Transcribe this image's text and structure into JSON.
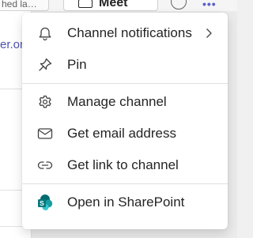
{
  "background": {
    "tab_text": "hed la…",
    "meet_label": "Meet",
    "link_text": "er.or"
  },
  "menu": {
    "items": [
      {
        "label": "Channel notifications",
        "icon": "bell-icon",
        "has_submenu": true
      },
      {
        "label": "Pin",
        "icon": "pin-icon"
      },
      {
        "label": "Manage channel",
        "icon": "gear-icon"
      },
      {
        "label": "Get email address",
        "icon": "mail-icon"
      },
      {
        "label": "Get link to channel",
        "icon": "link-icon"
      },
      {
        "label": "Open in SharePoint",
        "icon": "sharepoint-icon"
      }
    ]
  },
  "colors": {
    "text": "#242424",
    "icon": "#424242",
    "accent": "#5b5fc7",
    "sharepoint_dark": "#036c70",
    "sharepoint_mid": "#1a9ba1",
    "sharepoint_light": "#37c6d0"
  }
}
